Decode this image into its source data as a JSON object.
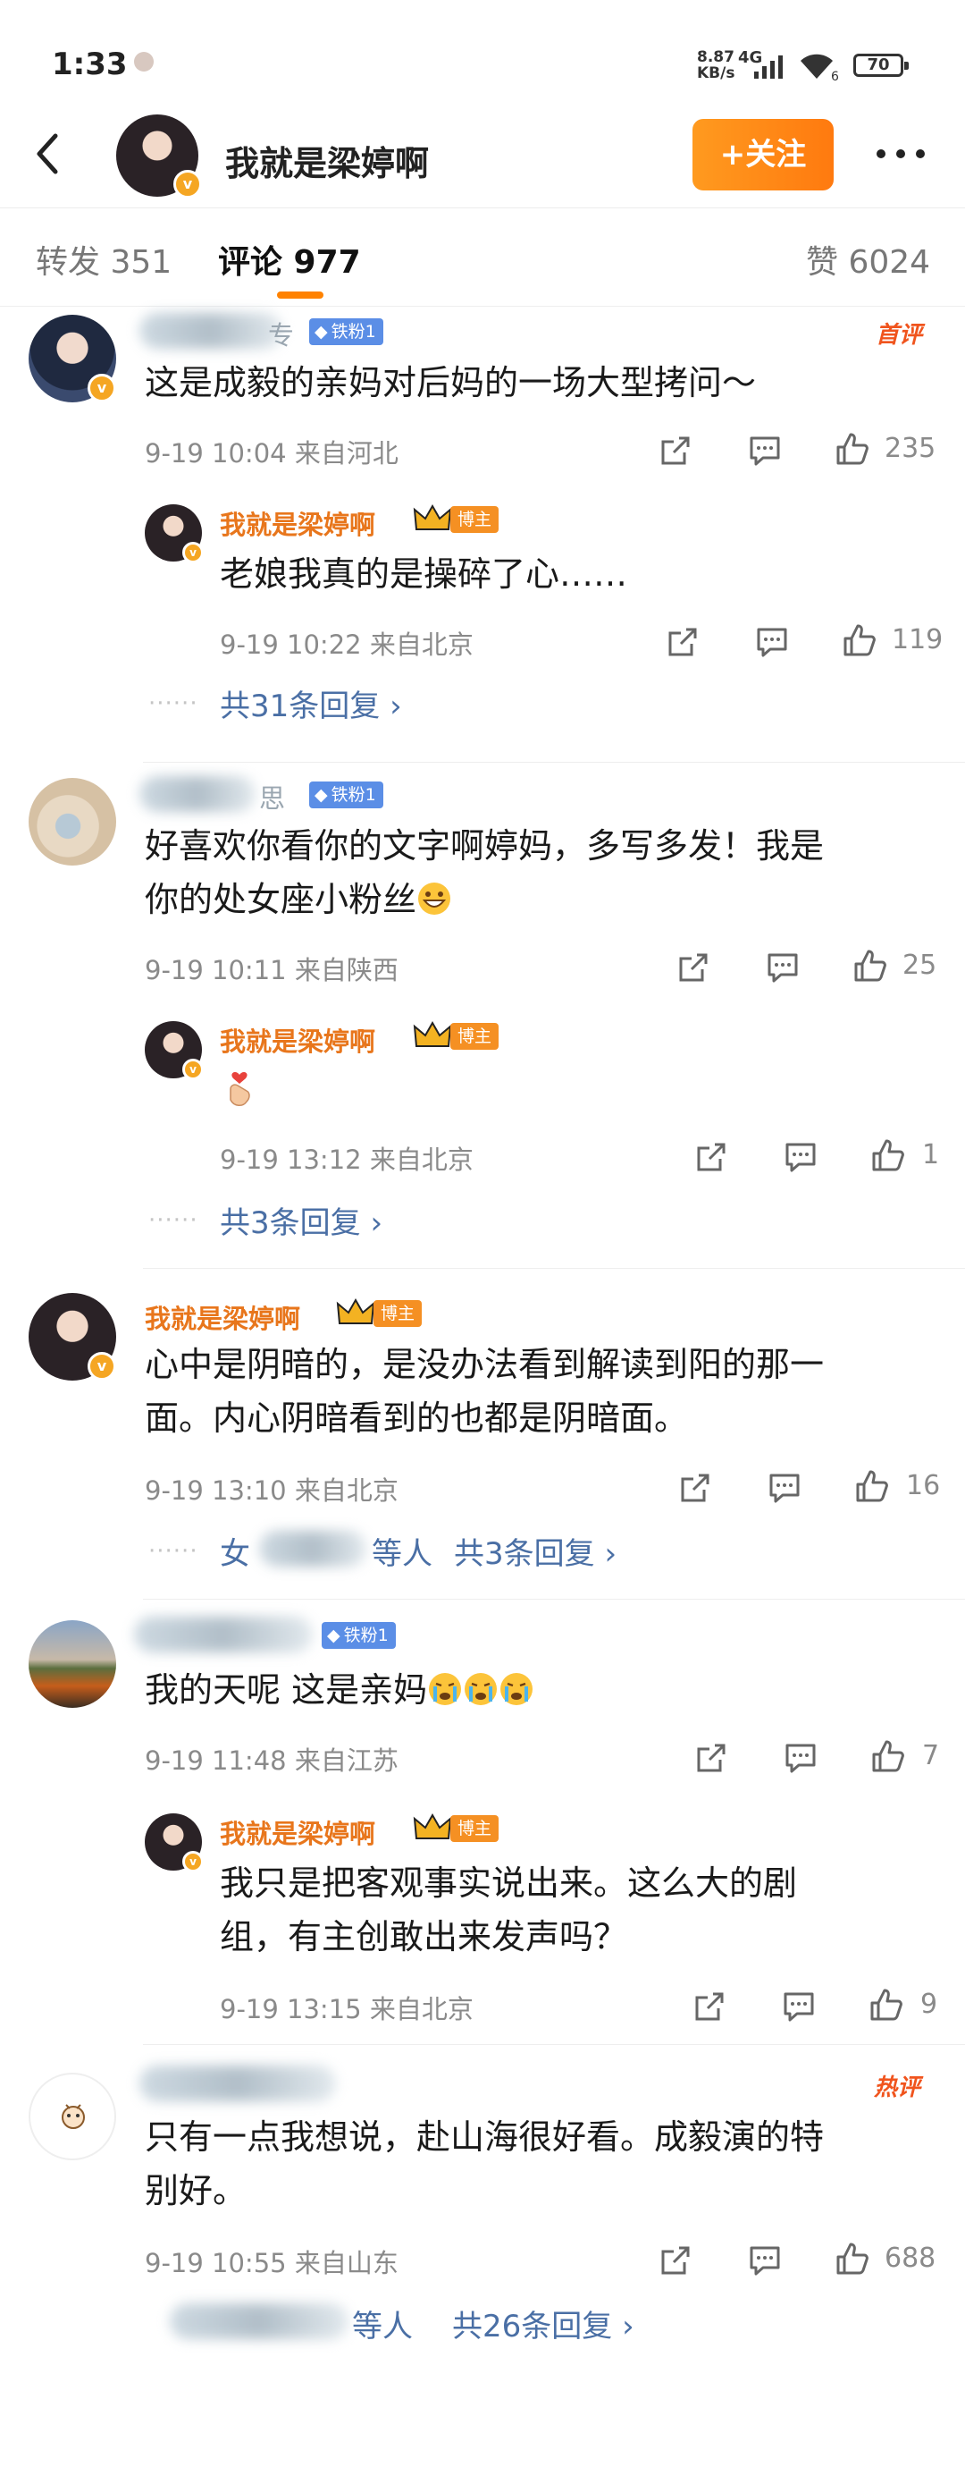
{
  "status_bar": {
    "time": "1:33",
    "speed": "8.87",
    "speed_unit": "KB/s",
    "network": "4G",
    "wifi_sub": "6",
    "battery": "70"
  },
  "header": {
    "title": "我就是梁婷啊",
    "follow_label": "+关注"
  },
  "tabs": [
    {
      "label": "转发 351"
    },
    {
      "label": "评论 977"
    },
    {
      "label": "赞 6024"
    }
  ],
  "comments": [
    {
      "name_suffix": "专",
      "fan_tag": "铁粉1",
      "hot_tag": "首评",
      "text": "这是成毅的亲妈对后妈的一场大型拷问～",
      "date": "9-19 10:04",
      "location": "来自河北",
      "likes": "235",
      "reply": {
        "name": "我就是梁婷啊",
        "tag": "博主",
        "text": "老娘我真的是操碎了心……",
        "date": "9-19 10:22",
        "location": "来自北京",
        "likes": "119"
      },
      "more_replies": "共31条回复"
    },
    {
      "name_suffix": "思",
      "fan_tag": "铁粉1",
      "text_line1": "好喜欢你看你的文字啊婷妈，多写多发！我是",
      "text_line2": "你的处女座小粉丝",
      "emoji": "grin",
      "date": "9-19 10:11",
      "location": "来自陕西",
      "likes": "25",
      "reply": {
        "name": "我就是梁婷啊",
        "tag": "博主",
        "emoji": "finger-heart",
        "date": "9-19 13:12",
        "location": "来自北京",
        "likes": "1"
      },
      "more_replies": "共3条回复"
    },
    {
      "name": "我就是梁婷啊",
      "tag": "博主",
      "text_line1": "心中是阴暗的，是没办法看到解读到阳的那一",
      "text_line2": "面。内心阴暗看到的也都是阴暗面。",
      "date": "9-19 13:10",
      "location": "来自北京",
      "likes": "16",
      "repliers_prefix": "女",
      "repliers_suffix": "等人",
      "more_replies": "共3条回复"
    },
    {
      "fan_tag": "铁粉1",
      "text": "我的天呢  这是亲妈",
      "emoji": "crying",
      "date": "9-19 11:48",
      "location": "来自江苏",
      "likes": "7",
      "reply": {
        "name": "我就是梁婷啊",
        "tag": "博主",
        "text_line1": "我只是把客观事实说出来。这么大的剧",
        "text_line2": "组，有主创敢出来发声吗？",
        "date": "9-19 13:15",
        "location": "来自北京",
        "likes": "9"
      }
    },
    {
      "hot_tag": "热评",
      "text_line1": "只有一点我想说，赴山海很好看。成毅演的特",
      "text_line2": "别好。",
      "date": "9-19 10:55",
      "location": "来自山东",
      "likes": "688",
      "repliers_suffix": "等人",
      "more_replies": "共26条回复"
    }
  ],
  "colors": {
    "accent": "#ff8200",
    "owner_name": "#e8761c",
    "link": "#4a6fa5",
    "fan_tag": "#5b8ee6",
    "hot": "#f0541d"
  }
}
